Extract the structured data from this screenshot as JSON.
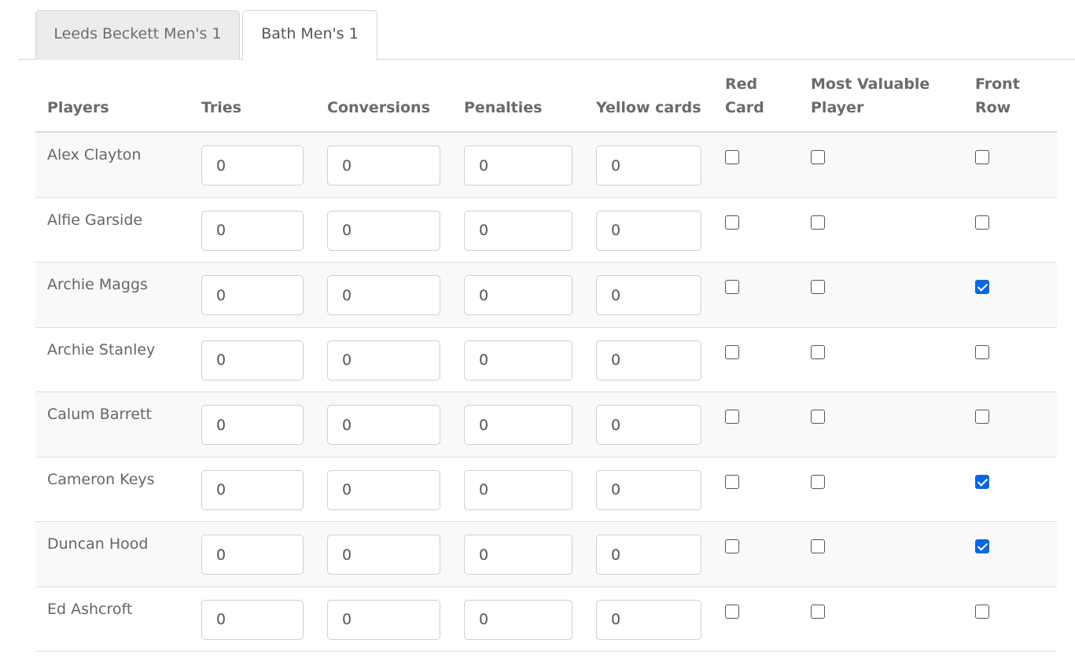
{
  "tabs": [
    {
      "label": "Leeds Beckett Men's 1",
      "active": false
    },
    {
      "label": "Bath Men's 1",
      "active": true
    }
  ],
  "table": {
    "headers": {
      "players": "Players",
      "tries": "Tries",
      "conversions": "Conversions",
      "penalties": "Penalties",
      "yellow_cards": "Yellow cards",
      "red_card_line1": "Red",
      "red_card_line2": "Card",
      "mvp_line1": "Most Valuable",
      "mvp_line2": "Player",
      "front_row_line1": "Front",
      "front_row_line2": "Row"
    },
    "rows": [
      {
        "player": "Alex Clayton",
        "tries": "0",
        "conversions": "0",
        "penalties": "0",
        "yellow_cards": "0",
        "red_card": false,
        "mvp": false,
        "front_row": false
      },
      {
        "player": "Alfie Garside",
        "tries": "0",
        "conversions": "0",
        "penalties": "0",
        "yellow_cards": "0",
        "red_card": false,
        "mvp": false,
        "front_row": false
      },
      {
        "player": "Archie Maggs",
        "tries": "0",
        "conversions": "0",
        "penalties": "0",
        "yellow_cards": "0",
        "red_card": false,
        "mvp": false,
        "front_row": true
      },
      {
        "player": "Archie Stanley",
        "tries": "0",
        "conversions": "0",
        "penalties": "0",
        "yellow_cards": "0",
        "red_card": false,
        "mvp": false,
        "front_row": false
      },
      {
        "player": "Calum Barrett",
        "tries": "0",
        "conversions": "0",
        "penalties": "0",
        "yellow_cards": "0",
        "red_card": false,
        "mvp": false,
        "front_row": false
      },
      {
        "player": "Cameron Keys",
        "tries": "0",
        "conversions": "0",
        "penalties": "0",
        "yellow_cards": "0",
        "red_card": false,
        "mvp": false,
        "front_row": true
      },
      {
        "player": "Duncan Hood",
        "tries": "0",
        "conversions": "0",
        "penalties": "0",
        "yellow_cards": "0",
        "red_card": false,
        "mvp": false,
        "front_row": true
      },
      {
        "player": "Ed Ashcroft",
        "tries": "0",
        "conversions": "0",
        "penalties": "0",
        "yellow_cards": "0",
        "red_card": false,
        "mvp": false,
        "front_row": false
      }
    ]
  },
  "colors": {
    "checkbox_checked": "#0b67e0",
    "row_stripe": "#f9f9f9",
    "border": "#dedede"
  }
}
